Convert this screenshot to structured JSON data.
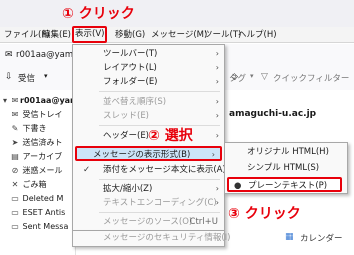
{
  "account": "r001aa@yamaguchi-u.ac.jp",
  "account_short": "r001aa@yama",
  "menubar": [
    "ファイル(F)",
    "編集(E)",
    "表示(V)",
    "移動(G)",
    "メッセージ(M)",
    "ツール(T)",
    "ヘルプ(H)"
  ],
  "annotations": {
    "click1": "① クリック",
    "select2": "② 選択",
    "click3": "③ クリック"
  },
  "toolbar": {
    "get_mail": "受信",
    "tag": "タグ",
    "quick_filter": "クイックフィルター"
  },
  "address_partial": "amaguchi-u.ac.jp",
  "folders": [
    {
      "icon": "inbox-icon",
      "glyph": "✉",
      "label": "受信トレイ"
    },
    {
      "icon": "draft-icon",
      "glyph": "✎",
      "label": "下書き"
    },
    {
      "icon": "sent-icon",
      "glyph": "➤",
      "label": "送信済みト"
    },
    {
      "icon": "archive-icon",
      "glyph": "▤",
      "label": "アーカイブ"
    },
    {
      "icon": "junk-icon",
      "glyph": "⊘",
      "label": "迷惑メール"
    },
    {
      "icon": "trash-icon",
      "glyph": "🗑",
      "label": "ごみ箱"
    },
    {
      "icon": "folder-icon",
      "glyph": "▭",
      "label": "Deleted M"
    },
    {
      "icon": "folder-icon",
      "glyph": "▭",
      "label": "ESET Antis"
    },
    {
      "icon": "folder-icon",
      "glyph": "▭",
      "label": "Sent Messa"
    }
  ],
  "view_menu": [
    {
      "label": "ツールバー(T)",
      "arrow": true
    },
    {
      "label": "レイアウト(L)",
      "arrow": true
    },
    {
      "label": "フォルダー(E)",
      "arrow": true
    },
    {
      "label": "並べ替え順序(S)",
      "arrow": true,
      "disabled": true
    },
    {
      "label": "スレッド(E)",
      "arrow": true,
      "disabled": true
    },
    {
      "label": "ヘッダー(E)",
      "arrow": true
    },
    {
      "label": "メッセージの表示形式(B)",
      "arrow": true,
      "highlight": true
    },
    {
      "label": "添付をメッセージ本文に表示(A)",
      "checked": true
    },
    {
      "label": "拡大/縮小(Z)",
      "arrow": true
    },
    {
      "label": "テキストエンコーディング(C)",
      "arrow": true,
      "disabled": true
    },
    {
      "label": "メッセージのソース(O)",
      "shortcut": "Ctrl+U",
      "disabled": true
    },
    {
      "label": "メッセージのセキュリティ情報(I)",
      "disabled": true
    }
  ],
  "submenu": [
    {
      "label": "オリジナル HTML(H)"
    },
    {
      "label": "シンプル HTML(S)"
    },
    {
      "label": "プレーンテキスト(P)",
      "selected": true
    }
  ],
  "calendar": "カレンダー"
}
